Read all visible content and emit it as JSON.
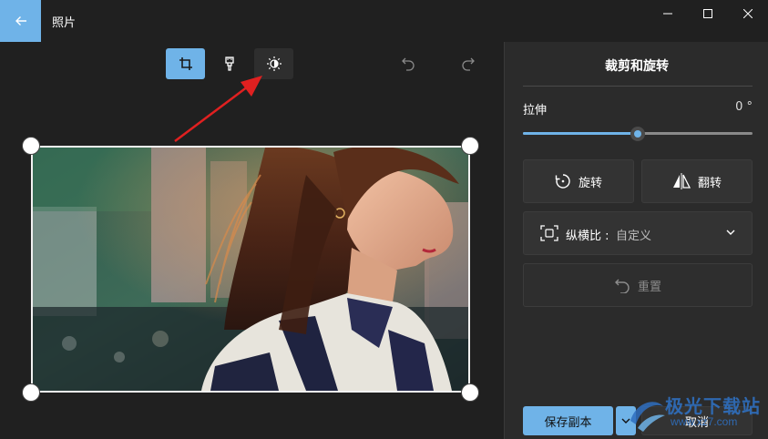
{
  "app": {
    "title": "照片"
  },
  "toolbar": {
    "tools": [
      "crop-icon",
      "markup-icon",
      "adjust-brightness-icon",
      "undo-icon",
      "redo-icon"
    ],
    "active_tool": "crop"
  },
  "panel": {
    "title": "裁剪和旋转",
    "stretch_label": "拉伸",
    "stretch_value": "0 °",
    "stretch_fraction": 0.5,
    "rotate_label": "旋转",
    "flip_label": "翻转",
    "aspect_label": "纵横比 :",
    "aspect_value": "自定义",
    "reset_label": "重置",
    "save_label": "保存副本",
    "cancel_label": "取消"
  },
  "watermark": {
    "name": "极光下载站",
    "url": "www.xz7.com"
  },
  "colors": {
    "accent": "#6fb3e8",
    "background": "#202020",
    "panel": "#2b2b2b",
    "annotation_arrow": "#e02020"
  }
}
